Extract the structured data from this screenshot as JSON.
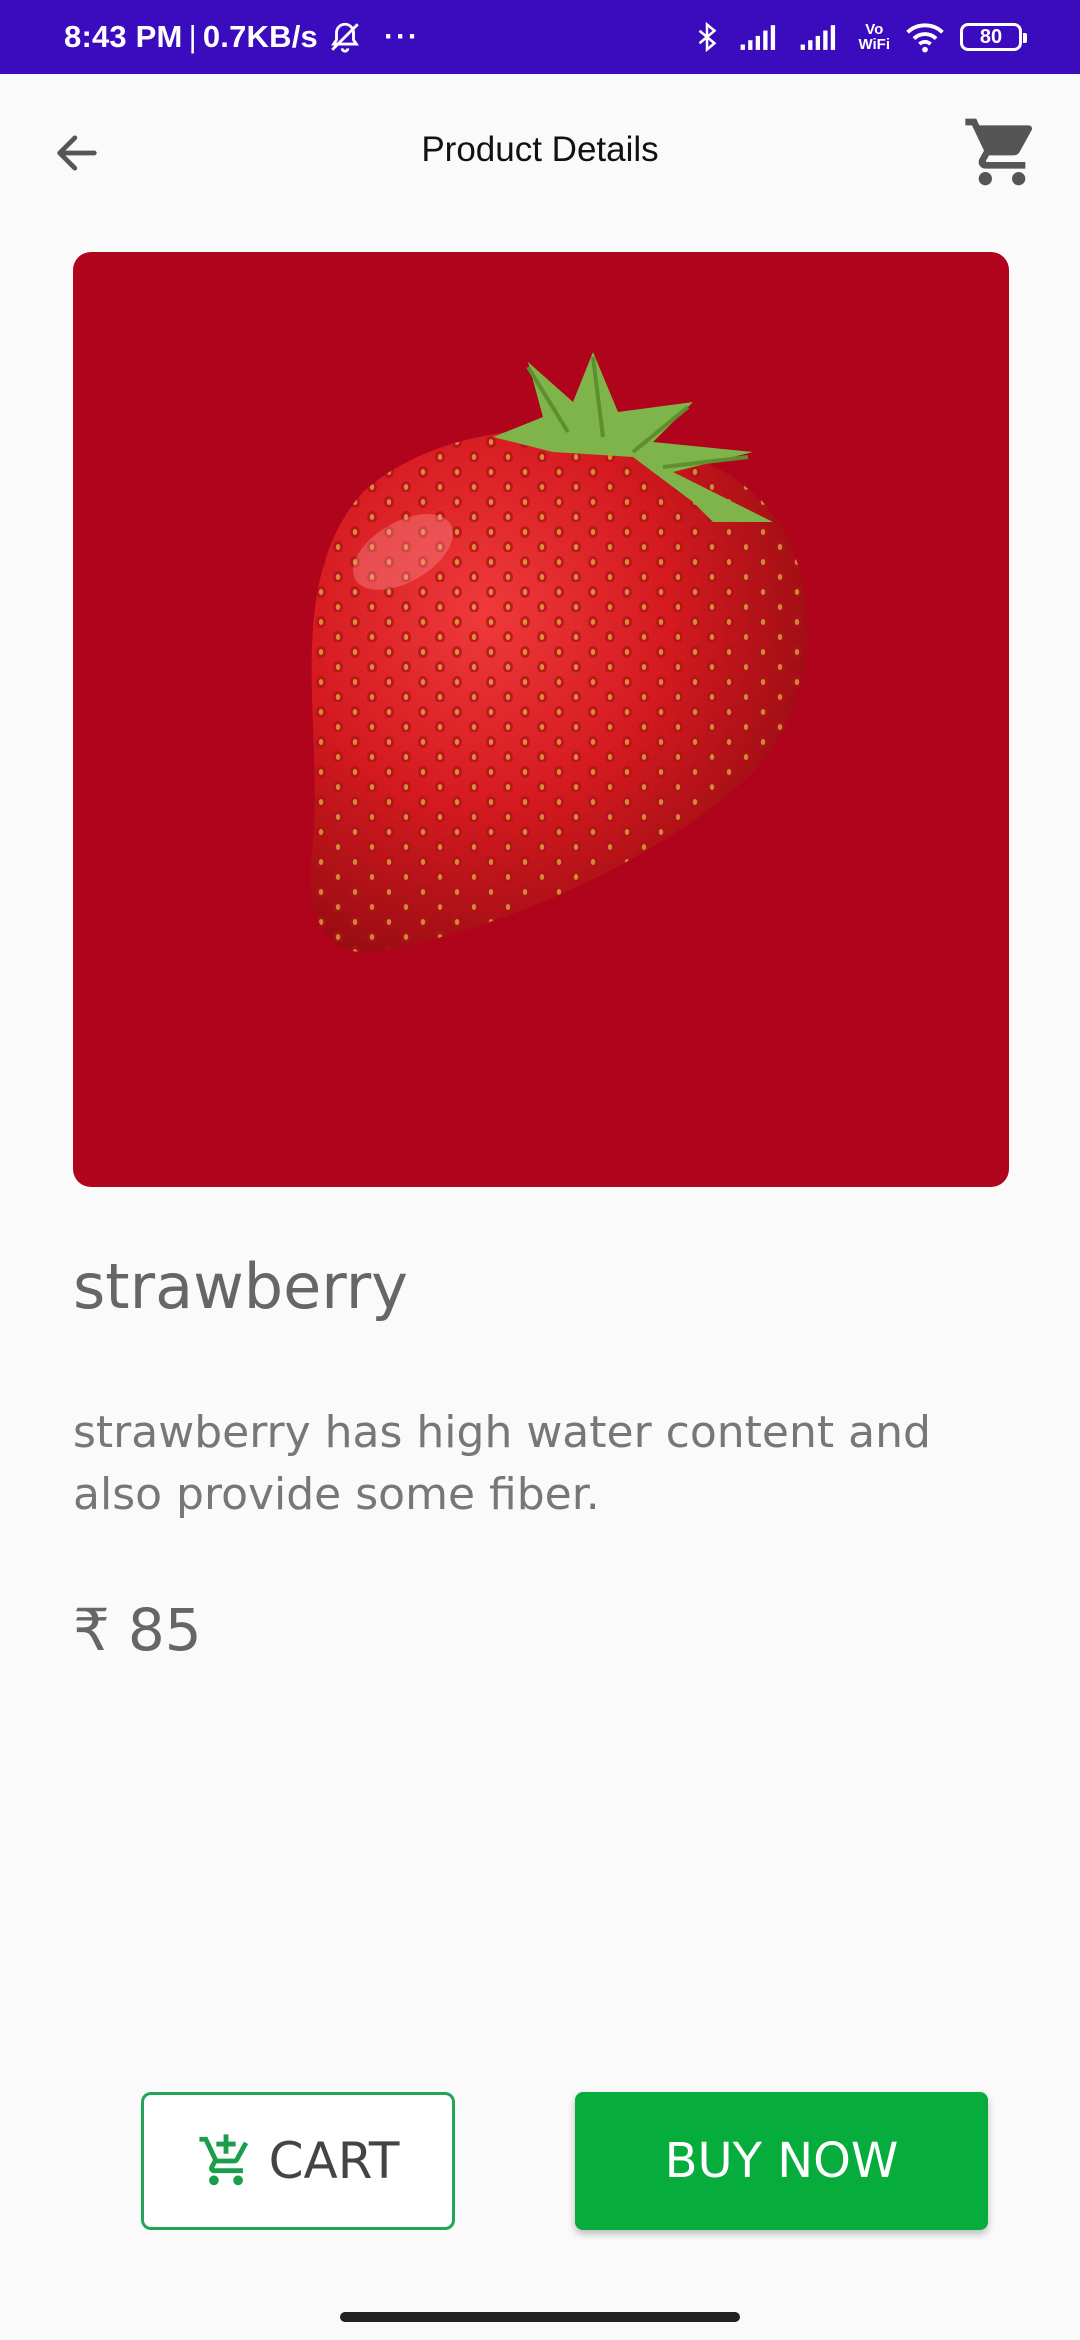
{
  "status_bar": {
    "time": "8:43 PM",
    "separator": "|",
    "network_speed": "0.7KB/s",
    "more": "···",
    "vowifi_top": "Vo",
    "vowifi_bottom": "WiFi",
    "battery": "80",
    "icons": [
      "bell-off-icon",
      "bluetooth-icon",
      "signal-icon",
      "signal-icon",
      "wifi-icon",
      "battery-icon"
    ]
  },
  "app_bar": {
    "title": "Product Details",
    "back_icon": "arrow-left-icon",
    "cart_icon": "shopping-cart-icon"
  },
  "product": {
    "name": "strawberry",
    "description": "strawberry has high water content and also provide some fiber.",
    "currency": "₹",
    "price": "85",
    "image_background": "#b0031c"
  },
  "actions": {
    "cart_label": "CART",
    "cart_icon": "add-to-cart-icon",
    "buy_label": "BUY NOW"
  },
  "colors": {
    "status_bar": "#3a0cbd",
    "accent_green": "#06ad3d",
    "cart_border": "#22a55a"
  }
}
